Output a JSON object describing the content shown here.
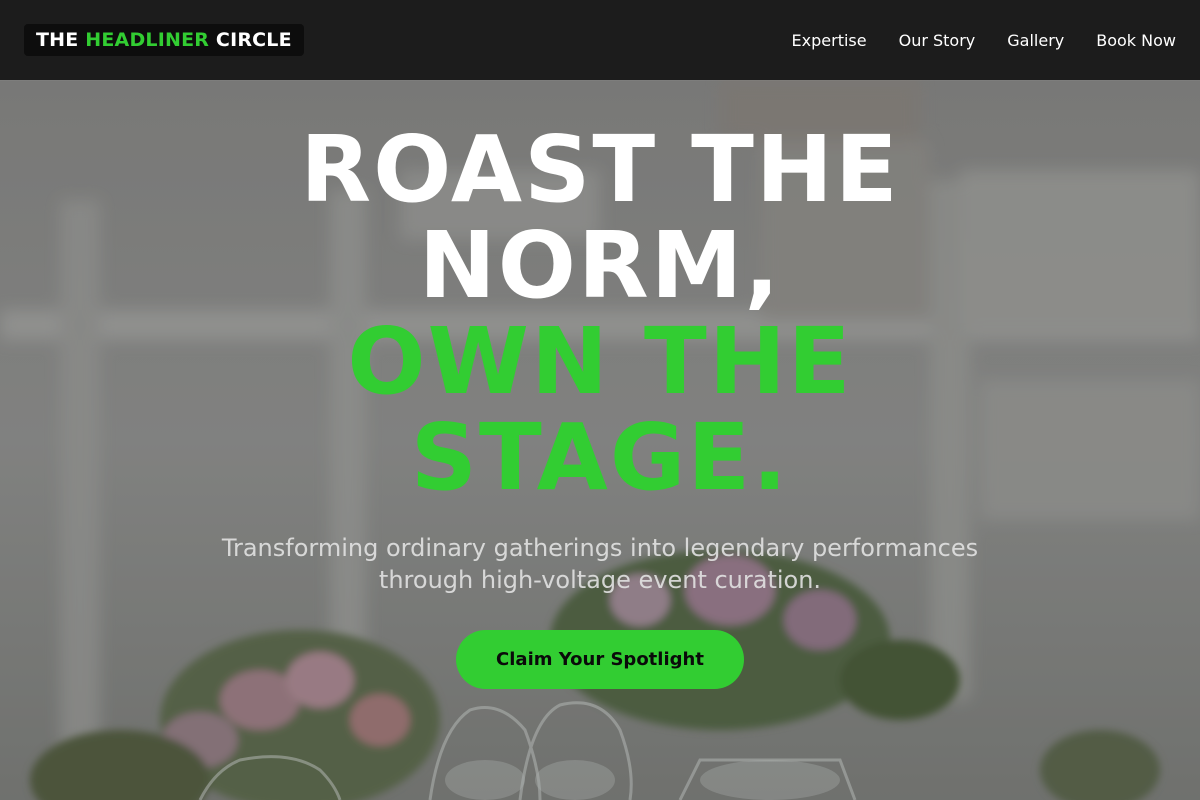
{
  "brand": {
    "part1": "THE ",
    "accent": "HEADLINER",
    "part2": " CIRCLE"
  },
  "nav": {
    "items": [
      "Expertise",
      "Our Story",
      "Gallery",
      "Book Now"
    ]
  },
  "hero": {
    "headline_white_1": "ROAST THE",
    "headline_white_2": "NORM,",
    "headline_green_1": "OWN THE",
    "headline_green_2": "STAGE.",
    "subtitle": "Transforming ordinary gatherings into legendary performances through high-voltage event curation.",
    "cta_label": "Claim Your Spotlight"
  },
  "colors": {
    "accent": "#32cd32",
    "nav_bg": "#1c1c1c",
    "text": "#ffffff"
  },
  "icons": {
    "background": "event-table-flowers-glassware-image"
  }
}
